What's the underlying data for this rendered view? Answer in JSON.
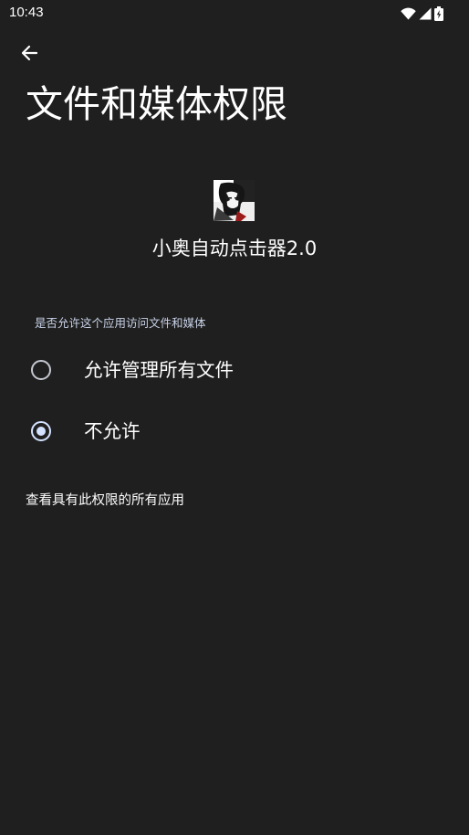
{
  "status_bar": {
    "time": "10:43",
    "icons": [
      "wifi-icon",
      "cell-signal-icon",
      "battery-charging-icon"
    ]
  },
  "header": {
    "back_icon": "arrow-back-icon",
    "title": "文件和媒体权限"
  },
  "app": {
    "icon": "app-avatar-icon",
    "name": "小奥自动点击器2.0"
  },
  "permission": {
    "label": "是否允许这个应用访问文件和媒体",
    "options": [
      {
        "label": "允许管理所有文件",
        "checked": false
      },
      {
        "label": "不允许",
        "checked": true
      }
    ]
  },
  "footer": {
    "view_all_label": "查看具有此权限的所有应用"
  },
  "colors": {
    "background": "#1f1f1f",
    "text": "#ffffff",
    "accent": "#d3e2ff",
    "radio_unchecked": "#c4c7cf"
  }
}
